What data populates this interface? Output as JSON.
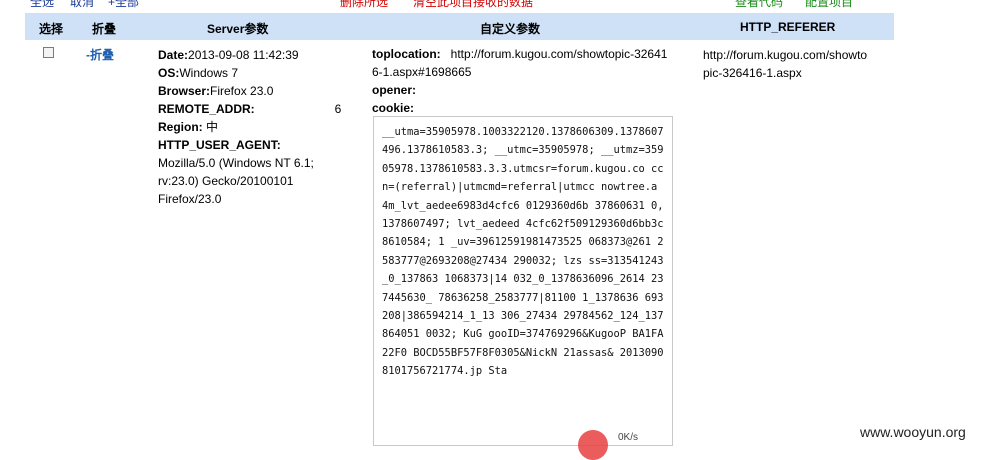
{
  "toolbar": {
    "select_all": "全选",
    "cancel": "取消",
    "all": "+全部",
    "delete_selected": "删除所选",
    "clear_data": "清空此项目接收的数据",
    "view_code": "查看代码",
    "config_project": "配置项目"
  },
  "table": {
    "headers": [
      "选择",
      "折叠",
      "Server参数",
      "自定义参数",
      "HTTP_REFERER"
    ]
  },
  "row": {
    "fold_label": "-折叠",
    "server": {
      "date_label": "Date:",
      "date_value": "2013-09-08 11:42:39",
      "os_label": "OS:",
      "os_value": "Windows 7",
      "browser_label": "Browser:",
      "browser_value": "Firefox 23.0",
      "remote_label": "REMOTE_ADDR:",
      "remote_value": "6",
      "region_label": "Region:",
      "region_value": "中",
      "ua_label": "HTTP_USER_AGENT:",
      "ua_value": "Mozilla/5.0 (Windows NT 6.1; rv:23.0) Gecko/20100101 Firefox/23.0"
    },
    "custom": {
      "toplocation_label": "toplocation:",
      "toplocation_value": "http://forum.kugou.com/showtopic-326416-1.aspx#1698665",
      "opener_label": "opener:",
      "cookie_label": "cookie:",
      "cookie_value": "__utma=35905978.1003322120.1378606309.1378607496.1378610583.3; __utmc=35905978; __utmz=35905978.1378610583.3.3.utmcsr=forum.kugou.co ccn=(referral)|utmcmd=referral|utmcc nowtree.a 4m_lvt_aedee6983d4cfc6 0129360d6b 37860631 0,1378607497; lvt_aedeed 4cfc62f509129360d6bb3c 8610584; 1 _uv=39612591981473525 068373@261 2583777@2693208@27434 290032; lzs ss=313541243_0_137863 1068373|14 032_0_1378636096_2614 237445630_ 78636258_2583777|81100 1_1378636 693208|386594214_1_13 306_27434 29784562_124_137864051 0032; KuG gooID=374769296&KugooP BA1FA22F0 BOCD55BF57F8F0305&NickN 21assas& 20130908101756721774.jp Sta"
    },
    "referer": "http://forum.kugou.com/showtopic-326416-1.aspx"
  },
  "overlay": {
    "text": "0K/s"
  },
  "watermark": "www.wooyun.org"
}
